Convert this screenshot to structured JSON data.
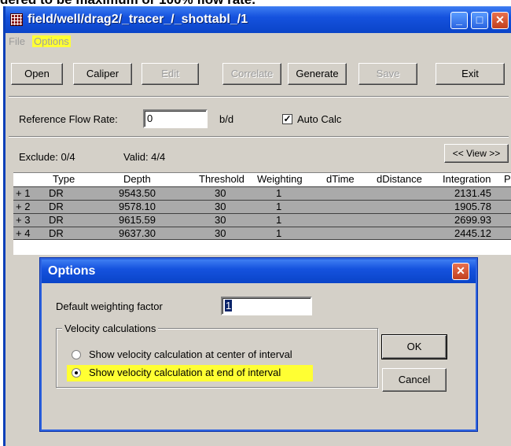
{
  "background_caption": "dered to be maximum or 100% flow rate.",
  "window": {
    "title": "field/well/drag2/_tracer_/_shottabl_/1"
  },
  "menu": {
    "file": "File",
    "options": "Options"
  },
  "toolbar": {
    "buttons": [
      "Open",
      "Caliper",
      "Edit",
      "Correlate",
      "Generate",
      "Save",
      "Exit"
    ]
  },
  "reference": {
    "label": "Reference Flow Rate:",
    "value": "0",
    "unit": "b/d",
    "auto_calc_label": "Auto Calc",
    "auto_calc_checked": true
  },
  "status": {
    "exclude": "Exclude:  0/4",
    "valid": "Valid:  4/4",
    "view_button": "<< View >>"
  },
  "table": {
    "columns": [
      "Type",
      "Depth",
      "Threshold",
      "Weighting",
      "dTime",
      "dDistance",
      "Integration",
      "P"
    ],
    "rows": [
      {
        "idx": "+  1",
        "type": "DR",
        "depth": "9543.50",
        "threshold": "30",
        "weighting": "1",
        "dtime": "",
        "ddistance": "",
        "integration": "2131.45"
      },
      {
        "idx": "+  2",
        "type": "DR",
        "depth": "9578.10",
        "threshold": "30",
        "weighting": "1",
        "dtime": "",
        "ddistance": "",
        "integration": "1905.78"
      },
      {
        "idx": "+  3",
        "type": "DR",
        "depth": "9615.59",
        "threshold": "30",
        "weighting": "1",
        "dtime": "",
        "ddistance": "",
        "integration": "2699.93"
      },
      {
        "idx": "+  4",
        "type": "DR",
        "depth": "9637.30",
        "threshold": "30",
        "weighting": "1",
        "dtime": "",
        "ddistance": "",
        "integration": "2445.12"
      }
    ]
  },
  "dialog": {
    "title": "Options",
    "weighting_label": "Default weighting factor",
    "weighting_value": "1",
    "group_label": "Velocity calculations",
    "option_center": "Show velocity calculation at center of interval",
    "option_end": "Show velocity calculation at end of interval",
    "selected": "end",
    "ok": "OK",
    "cancel": "Cancel"
  },
  "colors": {
    "highlight": "#ffff33",
    "title_blue": "#0a44c8",
    "row_gray": "#aaaaaa"
  }
}
